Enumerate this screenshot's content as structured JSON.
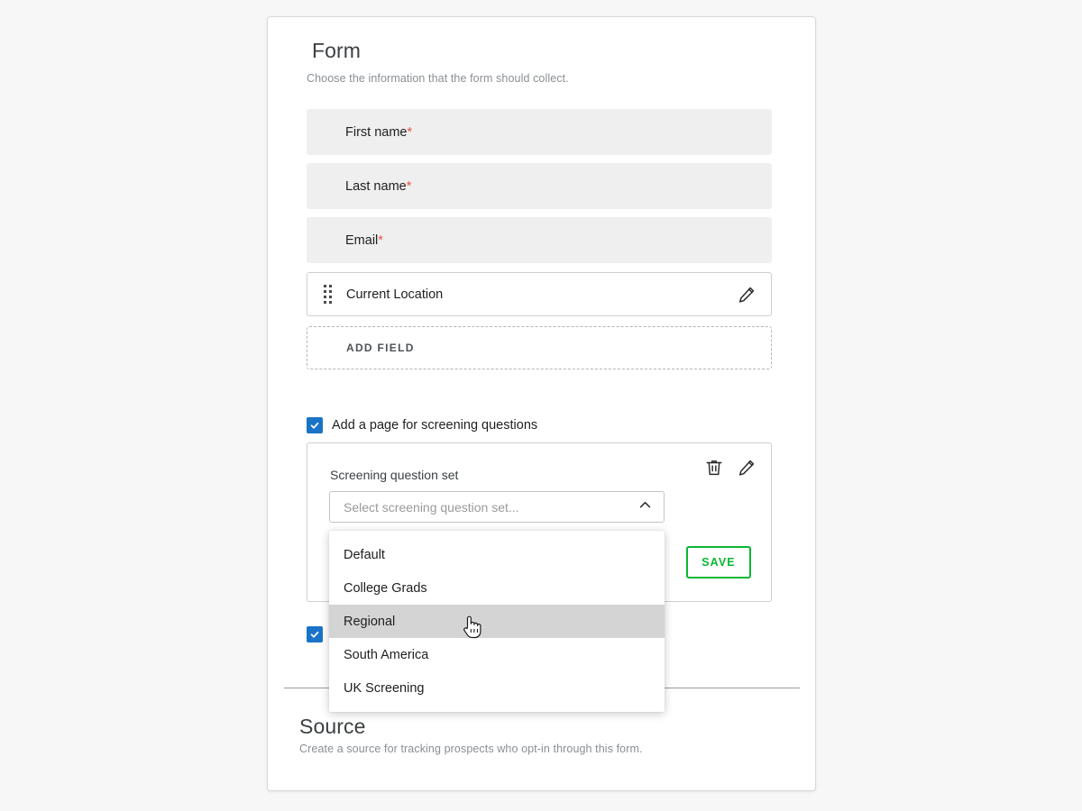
{
  "form_section": {
    "title": "Form",
    "subtitle": "Choose the information that the form should collect.",
    "fields": [
      {
        "label": "First name",
        "required_marker": "*",
        "type": "static"
      },
      {
        "label": "Last name",
        "required_marker": "*",
        "type": "static"
      },
      {
        "label": "Email",
        "required_marker": "*",
        "type": "static"
      },
      {
        "label": "Current Location",
        "required_marker": "",
        "type": "editable"
      }
    ],
    "add_field_label": "ADD FIELD"
  },
  "screening": {
    "checkbox_label": "Add a page for screening questions",
    "checkbox_checked": true,
    "panel_label": "Screening question set",
    "select_placeholder": "Select screening question set...",
    "select_value": "",
    "chevron_state": "up",
    "options": [
      "Default",
      "College Grads",
      "Regional",
      "South America",
      "UK Screening"
    ],
    "highlighted_option": "Regional",
    "save_label": "SAVE",
    "delete_icon": "trash-icon",
    "edit_icon": "pencil-icon"
  },
  "second_checkbox": {
    "checked": true,
    "label": ""
  },
  "source_section": {
    "title": "Source",
    "subtitle": "Create a source for tracking prospects who opt-in through this form."
  },
  "colors": {
    "checkbox_blue": "#1a73c7",
    "save_green": "#0bb634",
    "required_red": "#e8574a",
    "field_grey": "#efefef",
    "highlight_grey": "#d4d4d4"
  }
}
